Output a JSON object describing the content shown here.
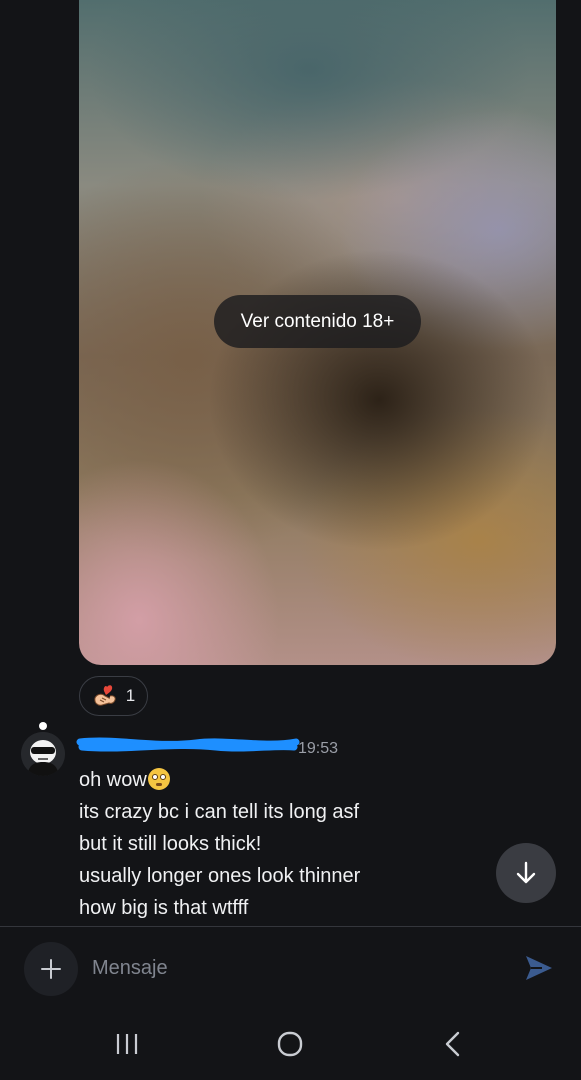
{
  "media": {
    "reveal_label": "Ver contenido 18+"
  },
  "reaction": {
    "emoji": "heart-hands-icon",
    "count": "1"
  },
  "message": {
    "username_redacted": "••••••••••••••",
    "timestamp": "19:53",
    "lines": [
      "oh wow",
      "its crazy bc i can tell its long asf",
      "but it still looks thick!",
      "usually longer ones look thinner",
      "how big is that wtfff"
    ],
    "emoji_after_first_line": "flushed-face-icon"
  },
  "composer": {
    "placeholder": "Mensaje"
  },
  "colors": {
    "background": "#131417",
    "send_accent": "#3b5b8f",
    "scribble": "#1e8fff"
  }
}
